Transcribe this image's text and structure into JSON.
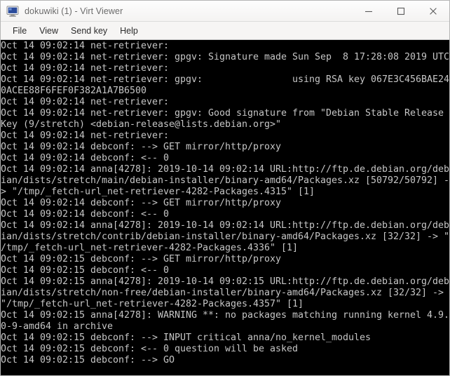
{
  "window": {
    "title": "dokuwiki (1) - Virt Viewer",
    "icon": "display-monitor-icon",
    "controls": {
      "minimize": "minimize-icon",
      "maximize": "maximize-icon",
      "close": "close-icon"
    }
  },
  "menubar": {
    "items": [
      {
        "label": "File"
      },
      {
        "label": "View"
      },
      {
        "label": "Send key"
      },
      {
        "label": "Help"
      }
    ]
  },
  "console": {
    "background_color": "#000000",
    "text_color": "#c6c6c6",
    "lines": [
      "Oct 14 09:02:14 net-retriever:",
      "Oct 14 09:02:14 net-retriever: gpgv: Signature made Sun Sep  8 17:28:08 2019 UTC",
      "Oct 14 09:02:14 net-retriever:",
      "Oct 14 09:02:14 net-retriever: gpgv:                using RSA key 067E3C456BAE24",
      "0ACEE88F6FEF0F382A1A7B6500",
      "Oct 14 09:02:14 net-retriever:",
      "Oct 14 09:02:14 net-retriever: gpgv: Good signature from \"Debian Stable Release",
      "Key (9/stretch) <debian-release@lists.debian.org>\"",
      "Oct 14 09:02:14 net-retriever:",
      "Oct 14 09:02:14 debconf: --> GET mirror/http/proxy",
      "Oct 14 09:02:14 debconf: <-- 0",
      "Oct 14 09:02:14 anna[4278]: 2019-10-14 09:02:14 URL:http://ftp.de.debian.org/deb",
      "ian/dists/stretch/main/debian-installer/binary-amd64/Packages.xz [50792/50792] -",
      "> \"/tmp/_fetch-url_net-retriever-4282-Packages.4315\" [1]",
      "Oct 14 09:02:14 debconf: --> GET mirror/http/proxy",
      "Oct 14 09:02:14 debconf: <-- 0",
      "Oct 14 09:02:14 anna[4278]: 2019-10-14 09:02:14 URL:http://ftp.de.debian.org/deb",
      "ian/dists/stretch/contrib/debian-installer/binary-amd64/Packages.xz [32/32] -> \"",
      "/tmp/_fetch-url_net-retriever-4282-Packages.4336\" [1]",
      "Oct 14 09:02:15 debconf: --> GET mirror/http/proxy",
      "Oct 14 09:02:15 debconf: <-- 0",
      "Oct 14 09:02:15 anna[4278]: 2019-10-14 09:02:15 URL:http://ftp.de.debian.org/deb",
      "ian/dists/stretch/non-free/debian-installer/binary-amd64/Packages.xz [32/32] ->",
      "\"/tmp/_fetch-url_net-retriever-4282-Packages.4357\" [1]",
      "Oct 14 09:02:15 anna[4278]: WARNING **: no packages matching running kernel 4.9.",
      "0-9-amd64 in archive",
      "Oct 14 09:02:15 debconf: --> INPUT critical anna/no_kernel_modules",
      "Oct 14 09:02:15 debconf: <-- 0 question will be asked",
      "Oct 14 09:02:15 debconf: --> GO"
    ]
  }
}
